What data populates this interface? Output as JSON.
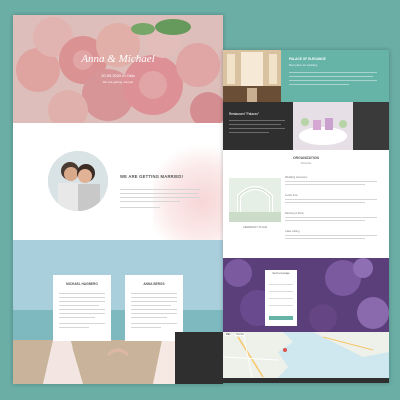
{
  "hero": {
    "couple_names": "Anna & Michael",
    "date": "20.09.2020 in Oslo",
    "tagline": "We are getting married"
  },
  "intro": {
    "heading": "WE ARE GETTING MARRIED!"
  },
  "profiles": [
    {
      "name": "MICHAEL HAGBERG"
    },
    {
      "name": "ANNA BERGS"
    }
  ],
  "venue": {
    "title": "PALACE OF ELEGANCE",
    "subtitle": "Best place for wedding",
    "restaurant_title": "Restaurant \"Palazzo\""
  },
  "organization": {
    "heading": "ORGANIZATION",
    "subheading": "Schedule",
    "left_caption": "CEREMONY PLACE",
    "items": [
      "Wedding ceremony",
      "Lunch time",
      "Dancing & Party",
      "Cake cutting"
    ]
  },
  "rsvp": {
    "title": "Send a message"
  },
  "map": {
    "tab_map": "Map",
    "tab_satellite": "Satellite"
  },
  "colors": {
    "background": "#6aaea6",
    "accent": "#66b3a8",
    "dark": "#2f2f2f"
  }
}
